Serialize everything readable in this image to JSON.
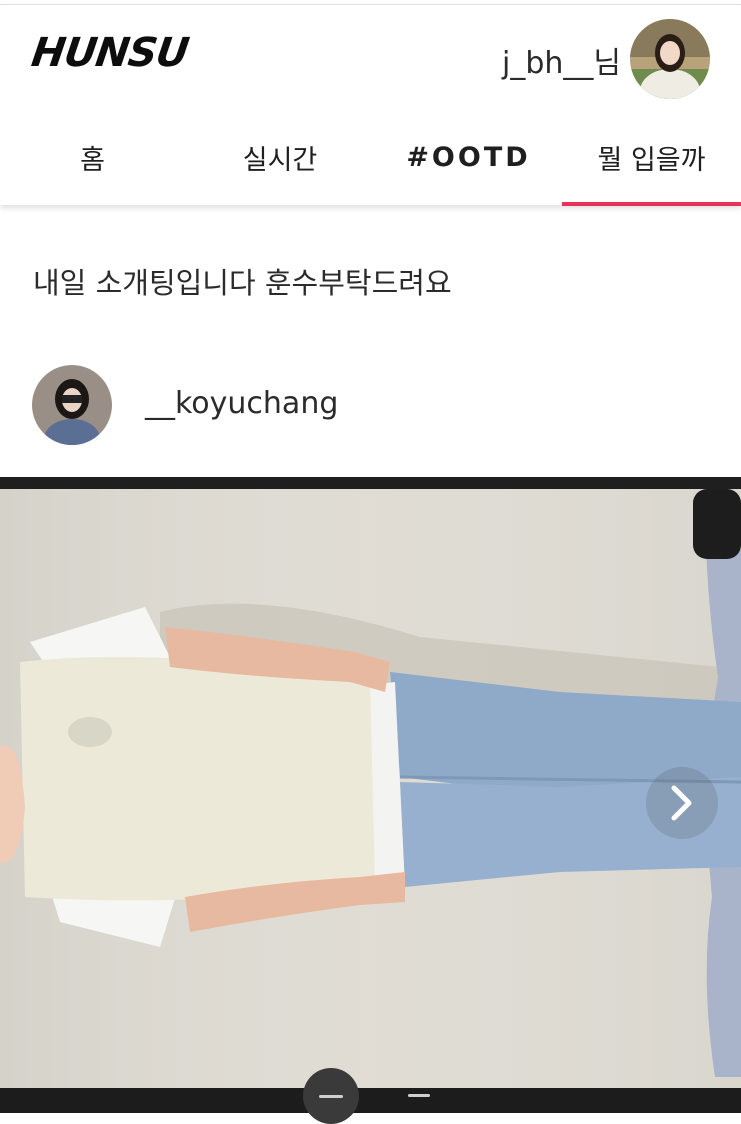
{
  "header": {
    "logo": "HUNSU",
    "username": "j_bh__님"
  },
  "tabs": [
    {
      "label": "홈"
    },
    {
      "label": "실시간"
    },
    {
      "label": "#OOTD"
    },
    {
      "label": "뭘 입을까"
    }
  ],
  "active_tab": "뭘 입을까",
  "post": {
    "question": "내일 소개팅입니다 훈수부탁드려요",
    "author": "__koyuchang"
  },
  "colors": {
    "accent": "#e5345a",
    "text": "#222222"
  },
  "icons": [
    "chevron-right-icon"
  ]
}
